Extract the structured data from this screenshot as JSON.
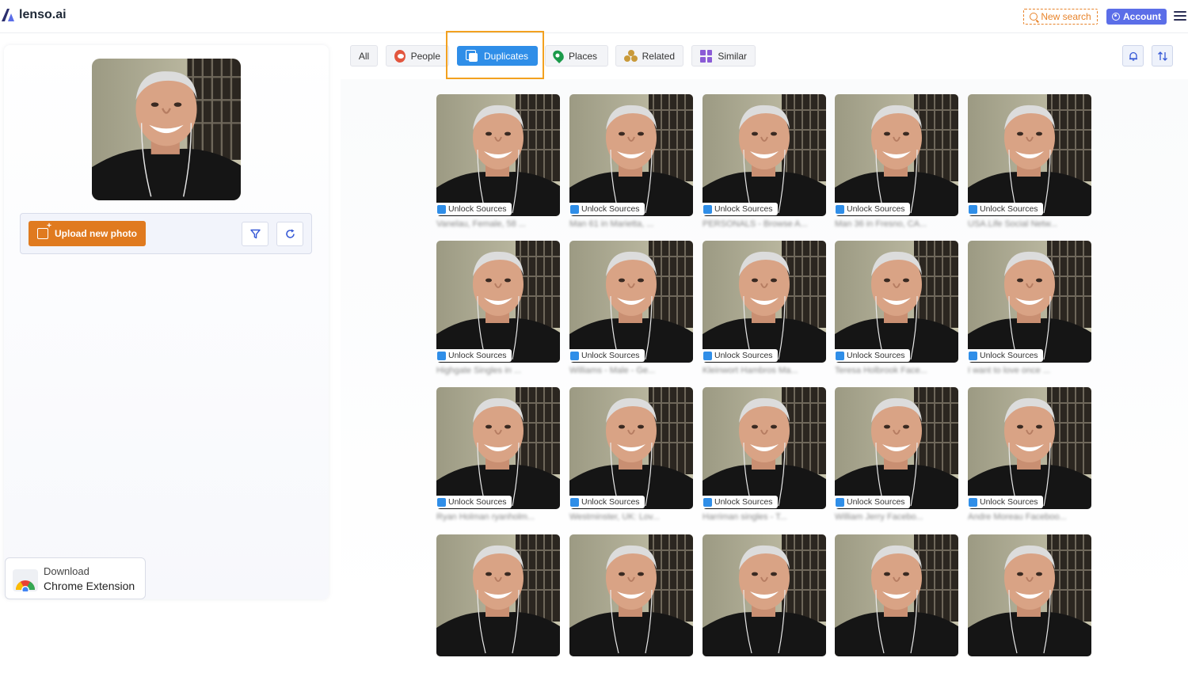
{
  "header": {
    "logo_text": "lenso.ai",
    "new_search_label": "New search",
    "account_label": "Account"
  },
  "left_panel": {
    "upload_label": "Upload new photo",
    "chrome_ext": {
      "line1": "Download",
      "line2": "Chrome Extension"
    }
  },
  "tabs": [
    {
      "label": "All",
      "icon": "none"
    },
    {
      "label": "People",
      "icon": "people-icon"
    },
    {
      "label": "Duplicates",
      "icon": "duplicates-icon",
      "active": true
    },
    {
      "label": "Places",
      "icon": "places-icon"
    },
    {
      "label": "Related",
      "icon": "related-icon"
    },
    {
      "label": "Similar",
      "icon": "similar-icon"
    }
  ],
  "results": {
    "unlock_label": "Unlock Sources",
    "captions": [
      "Vanelau, Female, 58 ...",
      "Man 61 in Marietta, ...",
      "PERSONALS - Browse A...",
      "Man 36 in Fresno, CA...",
      "USA.Life Social Netw...",
      "Highgate Singles in ...",
      "Williams - Male - Ge...",
      "Kleinwort Hambros Ma...",
      "Teresa Holbrook Face...",
      "I want to love once ...",
      "Ryan Holman ryanholm...",
      "Westminster, UK: Lov...",
      "Harriman singles - T...",
      "William Jerry Facebo...",
      "Andre Moreau Faceboo...",
      "",
      "",
      "",
      "",
      ""
    ]
  },
  "colors": {
    "accent_blue": "#2f8ee8",
    "upload_orange": "#e07a1f",
    "new_search_orange": "#e8842b",
    "account_purple": "#5b6ee8",
    "highlight_orange": "#f3a11f"
  }
}
